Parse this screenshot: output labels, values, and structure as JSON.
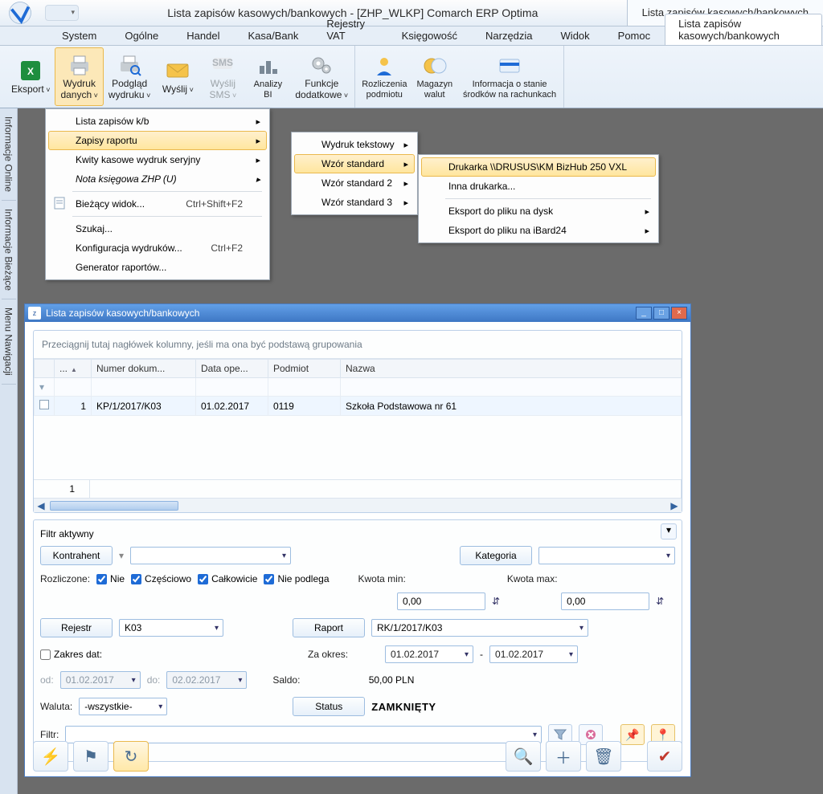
{
  "titlebar": {
    "title_center": "Lista zapisów kasowych/bankowych - [ZHP_WLKP] Comarch ERP Optima",
    "title_right_tab": "Lista zapisów kasowych/bankowych"
  },
  "ribbon_tabs": [
    "System",
    "Ogólne",
    "Handel",
    "Kasa/Bank",
    "Rejestry VAT",
    "Księgowość",
    "Narzędzia",
    "Widok",
    "Pomoc",
    "Lista zapisów kasowych/bankowych"
  ],
  "ribbon_active_tab": 9,
  "ribbon_buttons": {
    "eksport": "Eksport",
    "wydruk": "Wydruk\ndanych",
    "podglad": "Podgląd\nwydruku",
    "wyslij": "Wyślij",
    "wyslij_sms": "Wyślij\nSMS",
    "analizy": "Analizy\nBI",
    "funkcje": "Funkcje\ndodatkowe",
    "rozliczenia": "Rozliczenia\npodmiotu",
    "magazyn": "Magazyn\nwalut",
    "informacja": "Informacja o stanie\nśrodków na rachunkach"
  },
  "sidebar_tabs": [
    "Informacje Online",
    "Informacje Bieżące",
    "Menu Nawigacji"
  ],
  "menu1": {
    "items": [
      {
        "label": "Lista zapisów k/b",
        "sub": true
      },
      {
        "label": "Zapisy raportu",
        "sub": true,
        "hi": true
      },
      {
        "label": "Kwity kasowe wydruk seryjny",
        "sub": true
      },
      {
        "label": "Nota księgowa ZHP (U)",
        "sub": true,
        "italic": true
      },
      {
        "label": "Bieżący widok...",
        "shortcut": "Ctrl+Shift+F2",
        "icon": "sheet"
      },
      {
        "label": "Szukaj..."
      },
      {
        "label": "Konfiguracja wydruków...",
        "shortcut": "Ctrl+F2"
      },
      {
        "label": "Generator raportów..."
      }
    ]
  },
  "menu2": {
    "items": [
      {
        "label": "Wydruk tekstowy",
        "sub": true
      },
      {
        "label": "Wzór standard",
        "sub": true,
        "hi": true
      },
      {
        "label": "Wzór standard 2",
        "sub": true
      },
      {
        "label": "Wzór standard 3",
        "sub": true
      }
    ]
  },
  "menu3": {
    "items": [
      {
        "label": "Drukarka \\\\DRUSUS\\KM BizHub 250 VXL",
        "hi": true
      },
      {
        "label": "Inna drukarka..."
      },
      {
        "label": "Eksport do pliku na dysk",
        "sub": true
      },
      {
        "label": "Eksport do pliku na iBard24",
        "sub": true
      }
    ]
  },
  "childwin": {
    "title": "Lista zapisów kasowych/bankowych",
    "group_hint": "Przeciągnij tutaj nagłówek kolumny, jeśli ma ona być podstawą grupowania",
    "columns": [
      "...",
      "Numer dokum...",
      "Data ope...",
      "Podmiot",
      "Nazwa"
    ],
    "rows": [
      {
        "num": "1",
        "doc": "KP/1/2017/K03",
        "date": "01.02.2017",
        "podmiot": "0119",
        "nazwa": "Szkoła Podstawowa nr 61"
      }
    ],
    "footer_count": "1"
  },
  "filter": {
    "title": "Filtr aktywny",
    "kontrahent_btn": "Kontrahent",
    "kategoria_btn": "Kategoria",
    "rozliczone_label": "Rozliczone:",
    "chk_nie": "Nie",
    "chk_czesciowo": "Częściowo",
    "chk_calkowicie": "Całkowicie",
    "chk_niepodlega": "Nie podlega",
    "kwota_min": "Kwota min:",
    "kwota_max": "Kwota max:",
    "kwota_min_val": "0,00",
    "kwota_max_val": "0,00",
    "rejestr_btn": "Rejestr",
    "rejestr_val": "K03",
    "raport_btn": "Raport",
    "raport_val": "RK/1/2017/K03",
    "zakres_dat": "Zakres dat:",
    "od": "od:",
    "od_val": "01.02.2017",
    "do": "do:",
    "do_val": "02.02.2017",
    "za_okres": "Za okres:",
    "za_okres_from": "01.02.2017",
    "za_okres_to": "01.02.2017",
    "saldo": "Saldo:",
    "saldo_val": "50,00 PLN",
    "waluta": "Waluta:",
    "waluta_val": "-wszystkie-",
    "status_btn": "Status",
    "status_val": "ZAMKNIĘTY",
    "filtr_label": "Filtr:"
  }
}
